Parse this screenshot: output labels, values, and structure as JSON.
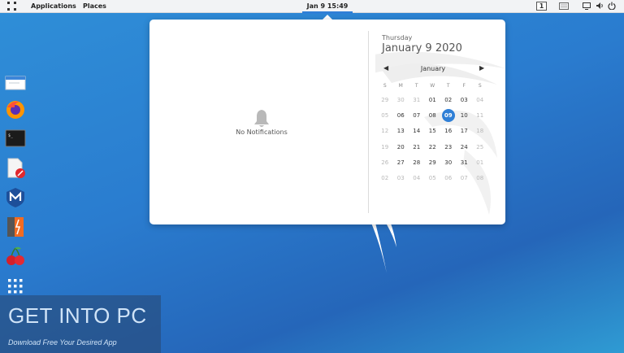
{
  "topbar": {
    "applications_label": "Applications",
    "places_label": "Places",
    "clock_label": "Jan 9  15:49",
    "workspace_number": "1"
  },
  "notifications": {
    "empty_label": "No Notifications"
  },
  "calendar": {
    "weekday": "Thursday",
    "full_date": "January 9 2020",
    "month": "January",
    "weekday_headers": [
      "S",
      "M",
      "T",
      "W",
      "T",
      "F",
      "S"
    ],
    "weeks": [
      [
        [
          "29",
          true
        ],
        [
          "30",
          true
        ],
        [
          "31",
          true
        ],
        [
          "01",
          false
        ],
        [
          "02",
          false
        ],
        [
          "03",
          false
        ],
        [
          "04",
          true
        ]
      ],
      [
        [
          "05",
          true
        ],
        [
          "06",
          false
        ],
        [
          "07",
          false
        ],
        [
          "08",
          false
        ],
        [
          "09",
          false
        ],
        [
          "10",
          false
        ],
        [
          "11",
          true
        ]
      ],
      [
        [
          "12",
          true
        ],
        [
          "13",
          false
        ],
        [
          "14",
          false
        ],
        [
          "15",
          false
        ],
        [
          "16",
          false
        ],
        [
          "17",
          false
        ],
        [
          "18",
          true
        ]
      ],
      [
        [
          "19",
          true
        ],
        [
          "20",
          false
        ],
        [
          "21",
          false
        ],
        [
          "22",
          false
        ],
        [
          "23",
          false
        ],
        [
          "24",
          false
        ],
        [
          "25",
          true
        ]
      ],
      [
        [
          "26",
          true
        ],
        [
          "27",
          false
        ],
        [
          "28",
          false
        ],
        [
          "29",
          false
        ],
        [
          "30",
          false
        ],
        [
          "31",
          false
        ],
        [
          "01",
          true
        ]
      ],
      [
        [
          "02",
          true
        ],
        [
          "03",
          true
        ],
        [
          "04",
          true
        ],
        [
          "05",
          true
        ],
        [
          "06",
          true
        ],
        [
          "07",
          true
        ],
        [
          "08",
          true
        ]
      ]
    ],
    "selected_day": "09"
  },
  "dock": {
    "items": [
      {
        "name": "files-icon"
      },
      {
        "name": "firefox-icon"
      },
      {
        "name": "terminal-icon"
      },
      {
        "name": "text-editor-icon"
      },
      {
        "name": "maltego-icon"
      },
      {
        "name": "burpsuite-icon"
      },
      {
        "name": "cherrytree-icon"
      },
      {
        "name": "show-applications-icon"
      }
    ]
  },
  "watermark": {
    "title": "GET INTO PC",
    "subtitle": "Download Free Your Desired App"
  },
  "colors": {
    "accent": "#2f7fd6",
    "panel": "#f2f3f5"
  }
}
